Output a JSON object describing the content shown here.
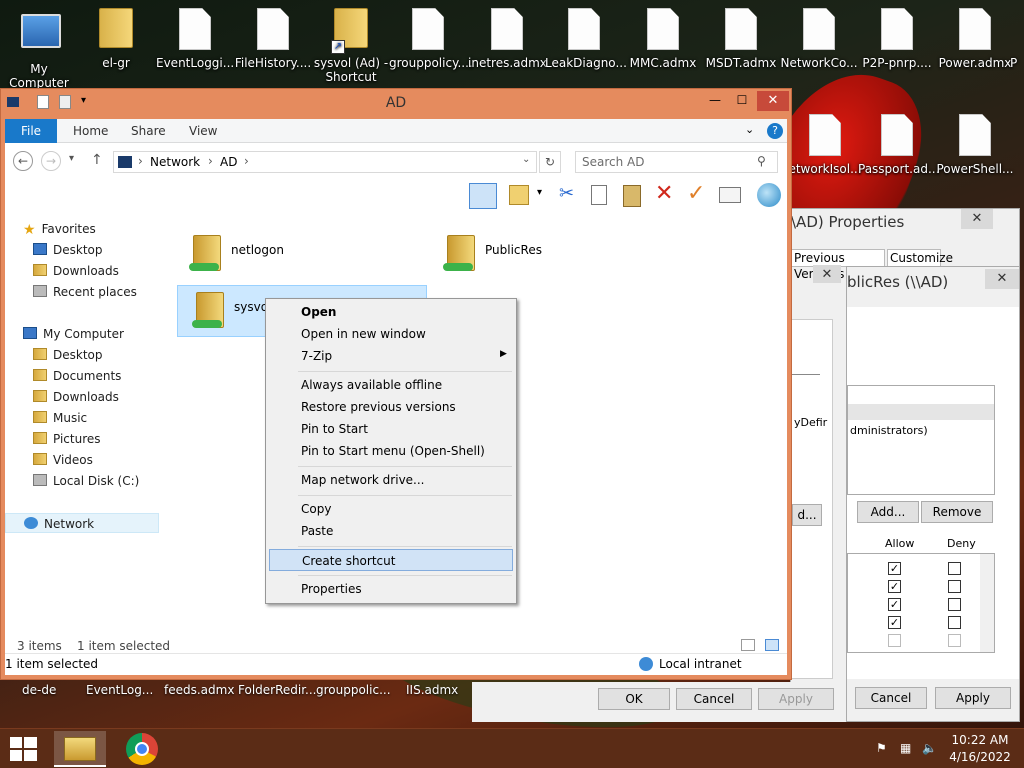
{
  "desktop": {
    "icons_top": [
      {
        "label": "My Computer"
      },
      {
        "label": "el-gr"
      },
      {
        "label": "EventLoggi..."
      },
      {
        "label": "FileHistory...."
      },
      {
        "label": "sysvol (Ad) - Shortcut"
      },
      {
        "label": "grouppolicy...."
      },
      {
        "label": "inetres.admx"
      },
      {
        "label": "LeakDiagno..."
      },
      {
        "label": "MMC.admx"
      },
      {
        "label": "MSDT.admx"
      },
      {
        "label": "NetworkCo..."
      },
      {
        "label": "P2P-pnrp...."
      },
      {
        "label": "Power.admx"
      },
      {
        "label": "P"
      }
    ],
    "icons_row2": [
      {
        "label": "etworkIsol..."
      },
      {
        "label": "Passport.ad..."
      },
      {
        "label": "PowerShell..."
      }
    ],
    "icons_bottom": [
      {
        "label": "de-de"
      },
      {
        "label": "EventLog..."
      },
      {
        "label": "feeds.admx"
      },
      {
        "label": "FolderRedir..."
      },
      {
        "label": "grouppolic..."
      },
      {
        "label": "IIS.admx"
      }
    ]
  },
  "explorer": {
    "title": "AD",
    "tabs": {
      "file": "File",
      "home": "Home",
      "share": "Share",
      "view": "View"
    },
    "breadcrumb": [
      "Network",
      "AD"
    ],
    "search_placeholder": "Search AD",
    "nav": {
      "favorites": "Favorites",
      "fav_items": [
        "Desktop",
        "Downloads",
        "Recent places"
      ],
      "mycomputer": "My Computer",
      "pc_items": [
        "Desktop",
        "Documents",
        "Downloads",
        "Music",
        "Pictures",
        "Videos",
        "Local Disk (C:)"
      ],
      "network": "Network"
    },
    "items": [
      {
        "label": "netlogon"
      },
      {
        "label": "PublicRes"
      },
      {
        "label": "sysvol"
      }
    ],
    "status_count": "3 items",
    "status_selected": "1 item selected",
    "statusbar_left": "1 item selected",
    "statusbar_zone": "Local intranet"
  },
  "context_menu": {
    "items": [
      {
        "label": "Open"
      },
      {
        "label": "Open in new window"
      },
      {
        "label": "7-Zip"
      },
      {
        "label": "Always available offline"
      },
      {
        "label": "Restore previous versions"
      },
      {
        "label": "Pin to Start"
      },
      {
        "label": "Pin to Start menu (Open-Shell)"
      },
      {
        "label": "Map network drive..."
      },
      {
        "label": "Copy"
      },
      {
        "label": "Paste"
      },
      {
        "label": "Create shortcut"
      },
      {
        "label": "Properties"
      }
    ]
  },
  "props_back": {
    "title": "\\AD) Properties",
    "tab_prev": "Previous Versions",
    "tab_custom": "Customize",
    "frag1": "yDefir",
    "btn_frag": "d...",
    "ok": "OK",
    "cancel": "Cancel",
    "apply": "Apply"
  },
  "props_front": {
    "title": "blicRes (\\\\AD)",
    "frag_admin": "dministrators)",
    "add": "Add...",
    "remove": "Remove",
    "allow": "Allow",
    "deny": "Deny",
    "cancel": "Cancel",
    "apply": "Apply"
  },
  "taskbar": {
    "time": "10:22 AM",
    "date": "4/16/2022"
  },
  "colors": {
    "accent": "#1979ca",
    "explorer_frame": "#e58b5e",
    "highlight": "#d1e3f6"
  }
}
